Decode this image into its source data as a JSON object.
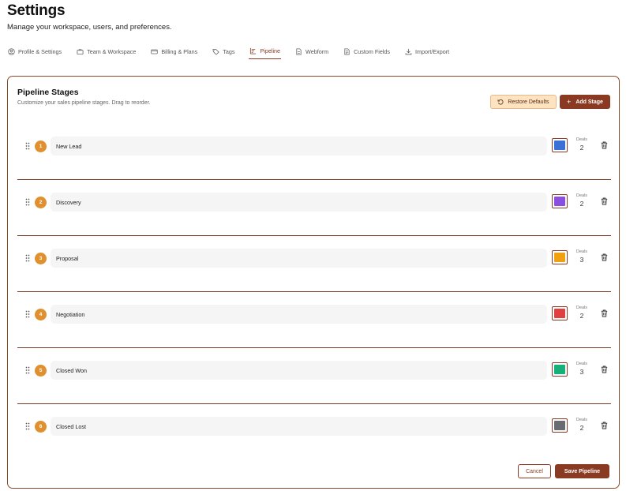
{
  "header": {
    "title": "Settings",
    "subtitle": "Manage your workspace, users, and preferences."
  },
  "tabs": [
    {
      "label": "Profile & Settings",
      "icon": "user-circle-icon"
    },
    {
      "label": "Team & Workspace",
      "icon": "briefcase-icon"
    },
    {
      "label": "Billing & Plans",
      "icon": "credit-card-icon"
    },
    {
      "label": "Tags",
      "icon": "tag-icon"
    },
    {
      "label": "Pipeline",
      "icon": "bar-chart-icon",
      "active": true
    },
    {
      "label": "Webform",
      "icon": "document-icon"
    },
    {
      "label": "Custom Fields",
      "icon": "list-document-icon"
    },
    {
      "label": "Import/Export",
      "icon": "download-icon"
    }
  ],
  "pipeline": {
    "title": "Pipeline Stages",
    "subtitle": "Customize your sales pipeline stages. Drag to reorder.",
    "restore_label": "Restore Defaults",
    "add_label": "Add Stage",
    "deals_label": "Deals",
    "stages": [
      {
        "number": "1",
        "name": "New Lead",
        "color": "#3b6fd8",
        "deals": "2"
      },
      {
        "number": "2",
        "name": "Discovery",
        "color": "#8a4fe0",
        "deals": "2"
      },
      {
        "number": "3",
        "name": "Proposal",
        "color": "#f0a010",
        "deals": "3"
      },
      {
        "number": "4",
        "name": "Negotiation",
        "color": "#e04040",
        "deals": "2"
      },
      {
        "number": "5",
        "name": "Closed Won",
        "color": "#18b07a",
        "deals": "3"
      },
      {
        "number": "6",
        "name": "Closed Lost",
        "color": "#6a6a72",
        "deals": "2"
      }
    ]
  },
  "footer": {
    "cancel_label": "Cancel",
    "save_label": "Save Pipeline"
  },
  "colors": {
    "accent": "#8a3a22",
    "badge": "#e0902e",
    "restore_bg": "#fde3c0"
  }
}
